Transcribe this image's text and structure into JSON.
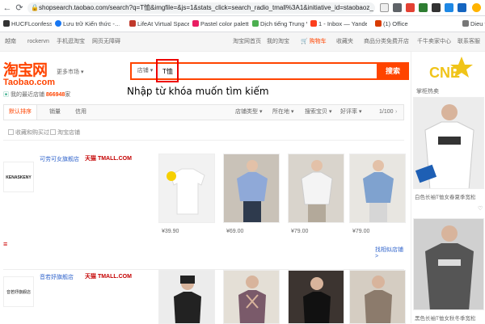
{
  "browser": {
    "url": "shopsearch.taobao.com/search?q=T恤&imgfile=&js=1&stats_click=search_radio_tmall%3A1&initiative_id=staobaoz_",
    "bookmarks": [
      "HUCFLconfessions (…",
      "Lưu trữ Kiến thức -…",
      "LifeAt Virtual Spaces",
      "Pastel color palette…",
      "Dịch tiếng Trung Vi…",
      "1 - Inbox — Yandex…",
      "(1) Office",
      "Dieu t"
    ]
  },
  "site_top": {
    "location": "越南",
    "user": "rockervn",
    "messages": "手机逛淘宝",
    "region": "网页无障碍",
    "home": "淘宝网首页",
    "my_taobao": "我的淘宝",
    "cart": "购物车",
    "favorites": "收藏夹",
    "goods_categories": "商品分类",
    "seller_center": "免费开店",
    "thousand_faces": "千牛卖家中心",
    "contact": "联系客服"
  },
  "logo": {
    "cn": "淘宝网",
    "en": "Taobao.com"
  },
  "more_market": "更多市场 ▾",
  "search": {
    "type_label": "店铺 ▾",
    "query": "T恤",
    "button": "搜索"
  },
  "annotation": "Nhập từ khóa muốn tìm kiếm",
  "recent_shop": {
    "label": "我的最近店铺",
    "count": "866948",
    "suffix": "家"
  },
  "sort_tabs": [
    "默认排序",
    "销量",
    "信用"
  ],
  "sort_dropdowns": [
    "店铺类型 ▾",
    "所在地 ▾",
    "搜索宝贝 ▾",
    "好评率 ▾"
  ],
  "pagination": "1/100",
  "filters": [
    "收藏和购买过",
    "淘宝店铺"
  ],
  "shops": [
    {
      "name": "可劳可女旗舰店",
      "badge": "天猫 TMALL.COM",
      "logo_text": "KENASKENY",
      "prices": [
        "¥39.90",
        "¥69.00",
        "¥79.00",
        "¥79.00"
      ],
      "more": "找相似店铺 >"
    },
    {
      "name": "音若妤旗舰店",
      "badge": "天猫 TMALL.COM",
      "logo_text": "音若妤旗舰店",
      "prices": [
        "",
        "",
        "",
        ""
      ]
    }
  ],
  "sidebar": {
    "cne_logo": "CNE",
    "ad_title": "掌柜热卖",
    "ads": [
      "白色长袖T恤女春夏季宽松",
      "黑色长袖T恤女秋冬季宽松"
    ]
  },
  "colors": {
    "brand": "#ff4400",
    "link": "#3366cc",
    "highlight": "#e00000"
  }
}
